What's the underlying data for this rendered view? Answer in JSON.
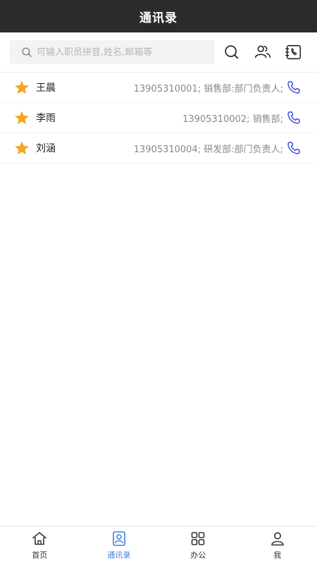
{
  "header": {
    "title": "通讯录"
  },
  "search": {
    "placeholder": "可输入职员拼音,姓名,邮箱等"
  },
  "toolbar": {
    "icons": [
      "search-icon",
      "group-contacts-icon",
      "phonebook-icon"
    ]
  },
  "contacts": [
    {
      "name": "王晨",
      "info": "13905310001; 销售部:部门负责人;",
      "starred": true
    },
    {
      "name": "李雨",
      "info": "13905310002; 销售部;",
      "starred": true
    },
    {
      "name": "刘涵",
      "info": "13905310004; 研发部:部门负责人;",
      "starred": true
    }
  ],
  "tabs": [
    {
      "label": "首页",
      "icon": "home-icon",
      "active": false
    },
    {
      "label": "通讯录",
      "icon": "contacts-icon",
      "active": true
    },
    {
      "label": "办公",
      "icon": "grid-icon",
      "active": false
    },
    {
      "label": "我",
      "icon": "user-icon",
      "active": false
    }
  ],
  "colors": {
    "header_bg": "#2b2b2b",
    "accent": "#3f7de0",
    "star": "#f5a623",
    "phone": "#3b4fd8"
  }
}
